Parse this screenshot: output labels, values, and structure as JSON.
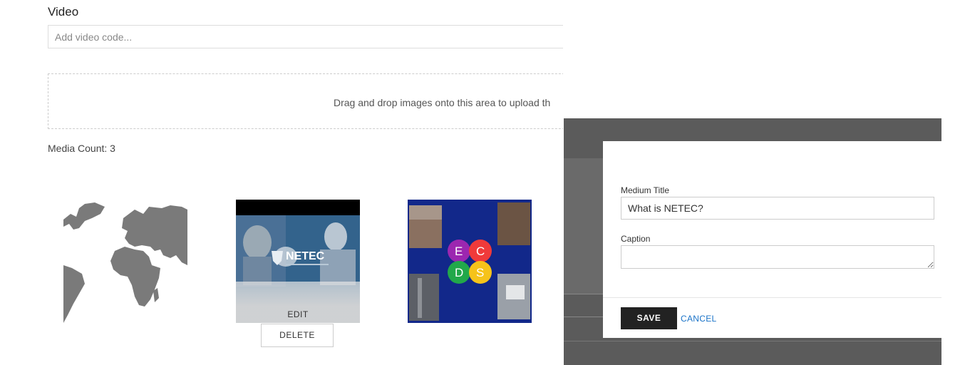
{
  "video": {
    "label": "Video",
    "placeholder": "Add video code..."
  },
  "dropzone": {
    "text": "Drag and drop images onto this area to upload th"
  },
  "media": {
    "count_label": "Media Count: 3",
    "items": [
      {
        "image": "world-map"
      },
      {
        "image": "netec-video-still",
        "edit_label": "EDIT",
        "delete_label": "DELETE"
      },
      {
        "image": "ecds-collage"
      }
    ]
  },
  "modal": {
    "title_label": "Medium Title",
    "title_value": "What is NETEC?",
    "caption_label": "Caption",
    "caption_value": "",
    "save_label": "SAVE",
    "cancel_label": "CANCEL"
  },
  "colors": {
    "overlay": "#5b5b5b",
    "save_bg": "#222222",
    "cancel_link": "#1a73c8"
  }
}
